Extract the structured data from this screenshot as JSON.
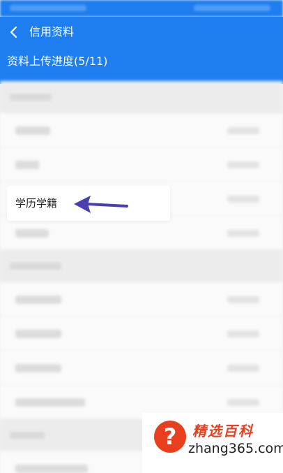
{
  "header": {
    "title": "信用资料",
    "progress_text": "资料上传进度(5/11)"
  },
  "highlighted_item": {
    "label": "学历学籍"
  },
  "watermark": {
    "logo_icon": "question-mark-icon",
    "logo_glyph": "?",
    "title": "精选百科",
    "domain": "zhang365.com"
  },
  "colors": {
    "app_bar": "#1e7ef0",
    "arrow": "#4a3fb0",
    "watermark_accent": "#e8401f"
  }
}
